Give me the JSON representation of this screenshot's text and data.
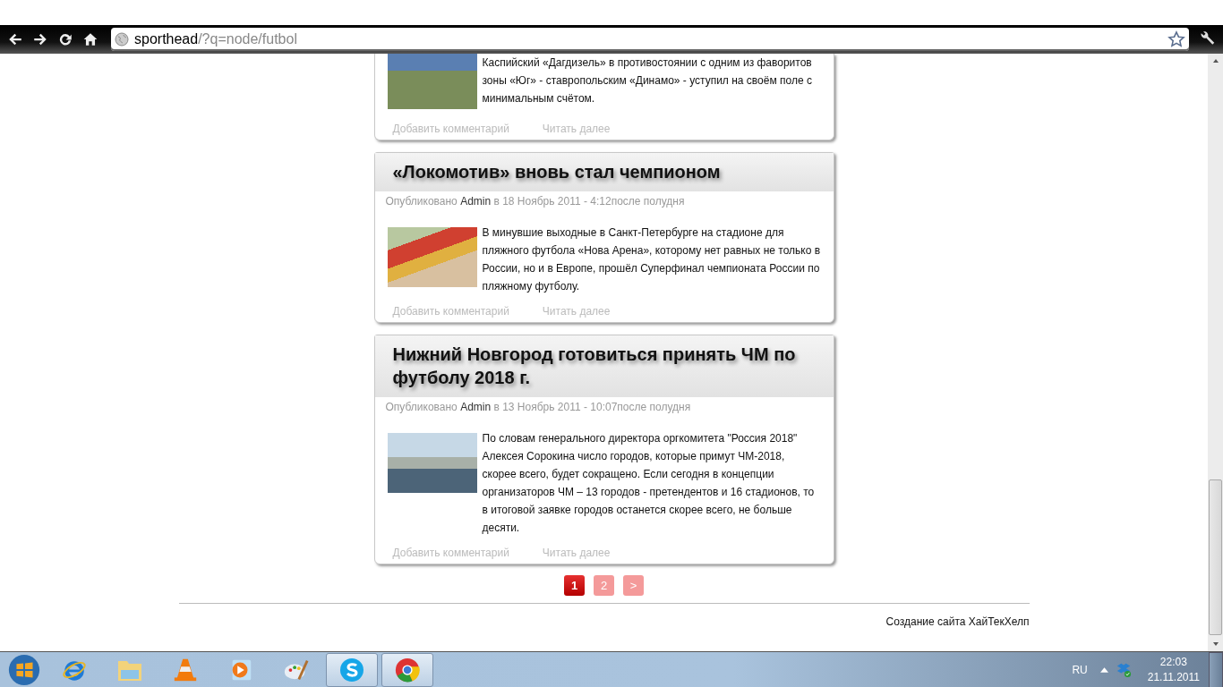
{
  "browser": {
    "url_host": "sporthead",
    "url_path": "/?q=node/futbol"
  },
  "articles": [
    {
      "text": " Каспийский «Дагдизель» в противостоянии с одним из фаворитов зоны «Юг» - ставропольским «Динамо» - уступил на своём поле с минимальным счётом.",
      "links": [
        "Добавить комментарий",
        "Читать далее"
      ]
    },
    {
      "title": "«Локомотив» вновь стал чемпионом",
      "meta": {
        "prefix": "Опубликовано",
        "author": "Admin",
        "suffix": "в 18 Ноябрь 2011 - 4:12после полудня"
      },
      "text": " В минувшие выходные в Санкт-Петербурге на стадионе для пляжного футбола «Нова Арена», которому нет равных не только в России, но и в Европе,  прошёл Суперфинал чемпионата России по пляжному футболу.",
      "links": [
        "Добавить комментарий",
        "Читать далее"
      ]
    },
    {
      "title": "Нижний Новгород готовиться принять ЧМ по футболу 2018 г.",
      "meta": {
        "prefix": "Опубликовано",
        "author": "Admin",
        "suffix": "в 13 Ноябрь 2011 - 10:07после полудня"
      },
      "text": " По словам генерального директора оргкомитета \"Россия 2018\" Алексея Сорокина число городов, которые примут ЧМ-2018, скорее всего, будет сокращено.  Если  сегодня в концепции организаторов ЧМ – 13 городов - претендентов и 16 стадионов, то в итоговой заявке городов останется скорее всего, не больше десяти.",
      "links": [
        "Добавить комментарий",
        "Читать далее"
      ]
    }
  ],
  "pager": [
    {
      "label": "1",
      "selected": true
    },
    {
      "label": "2",
      "selected": false
    },
    {
      "label": ">",
      "selected": false
    }
  ],
  "footer": "Создание сайта ХайТекХелп",
  "taskbar": {
    "apps": [
      {
        "kind": "ie",
        "running": false
      },
      {
        "kind": "folder",
        "running": false
      },
      {
        "kind": "cone",
        "running": false
      },
      {
        "kind": "player",
        "running": false
      },
      {
        "kind": "paint",
        "running": false
      },
      {
        "kind": "skype",
        "running": true
      },
      {
        "kind": "chrome",
        "running": true
      }
    ],
    "language": "RU",
    "time": "22:03",
    "date": "21.11.2011"
  }
}
